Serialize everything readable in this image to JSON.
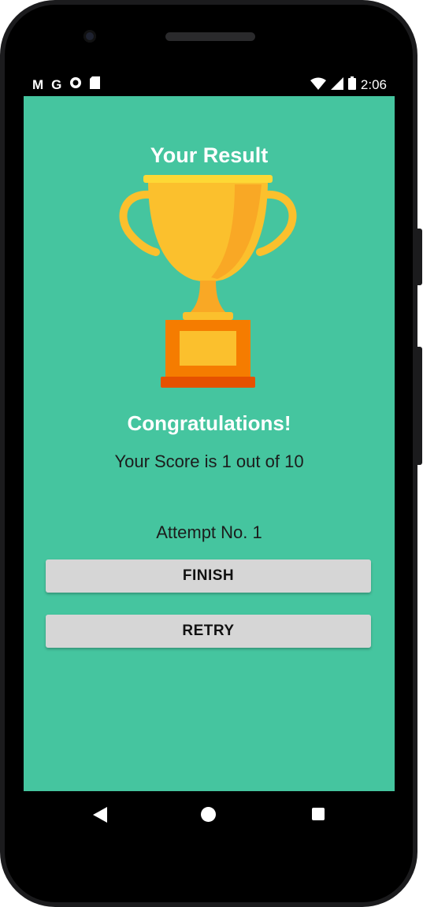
{
  "status_bar": {
    "icons_left": [
      "gmail-icon",
      "google-icon",
      "record-icon",
      "sd-card-icon"
    ],
    "icons_right": [
      "wifi-icon",
      "signal-icon",
      "battery-icon"
    ],
    "time": "2:06"
  },
  "result": {
    "title": "Your Result",
    "image": "trophy-icon",
    "congrats": "Congratulations!",
    "score_text": "Your Score is 1 out of 10",
    "attempt_text": "Attempt No. 1"
  },
  "buttons": {
    "finish_label": "FINISH",
    "retry_label": "RETRY"
  },
  "colors": {
    "background": "#45c59f",
    "trophy_gold": "#fbc02d",
    "trophy_base": "#f57c00",
    "button_bg": "#d6d6d6"
  },
  "nav_bar": {
    "icons": [
      "back-icon",
      "home-icon",
      "recents-icon"
    ]
  }
}
